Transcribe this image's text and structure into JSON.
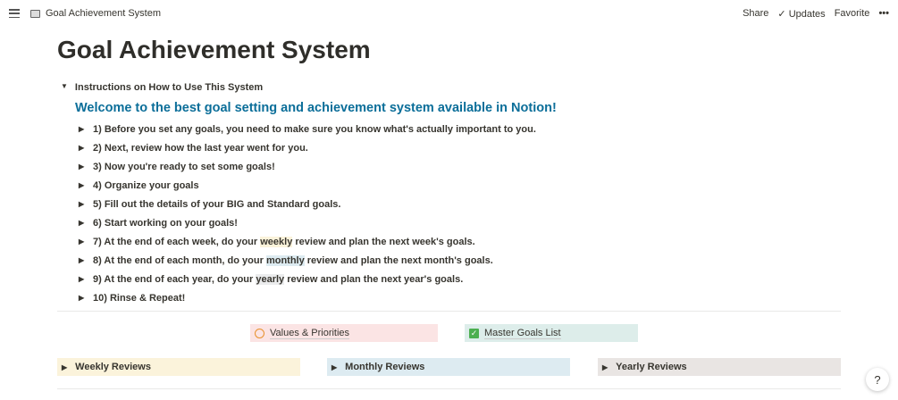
{
  "topbar": {
    "breadcrumb": "Goal Achievement System",
    "share": "Share",
    "updates": "Updates",
    "favorite": "Favorite",
    "more": "•••"
  },
  "title": "Goal Achievement System",
  "instructions_toggle": "Instructions on How to Use This System",
  "welcome": "Welcome to the best goal setting and achievement system available in Notion!",
  "items": [
    {
      "pre": "1) Before you set any goals, you need to make sure you know what's actually important to you.",
      "hl": "",
      "post": ""
    },
    {
      "pre": "2) Next, review how the last year went for you.",
      "hl": "",
      "post": ""
    },
    {
      "pre": "3) Now you're ready to set some goals!",
      "hl": "",
      "post": ""
    },
    {
      "pre": "4) Organize your goals",
      "hl": "",
      "post": ""
    },
    {
      "pre": "5) Fill out the details of your BIG and Standard goals.",
      "hl": "",
      "post": ""
    },
    {
      "pre": "6) Start working on your goals!",
      "hl": "",
      "post": ""
    },
    {
      "pre": "7) At the end of each week, do your ",
      "hl": "weekly",
      "post": " review and plan the next week's goals."
    },
    {
      "pre": "8) At the end of each month, do your ",
      "hl": "monthly",
      "post": " review and plan the next month's goals."
    },
    {
      "pre": "9) At the end of each year, do your ",
      "hl": "yearly",
      "post": " review and plan the next year's goals."
    },
    {
      "pre": "10) Rinse & Repeat!",
      "hl": "",
      "post": ""
    }
  ],
  "links": {
    "values": "Values & Priorities",
    "master": "Master Goals List"
  },
  "reviews": {
    "weekly": "Weekly Reviews",
    "monthly": "Monthly Reviews",
    "yearly": "Yearly Reviews"
  },
  "help": "?"
}
